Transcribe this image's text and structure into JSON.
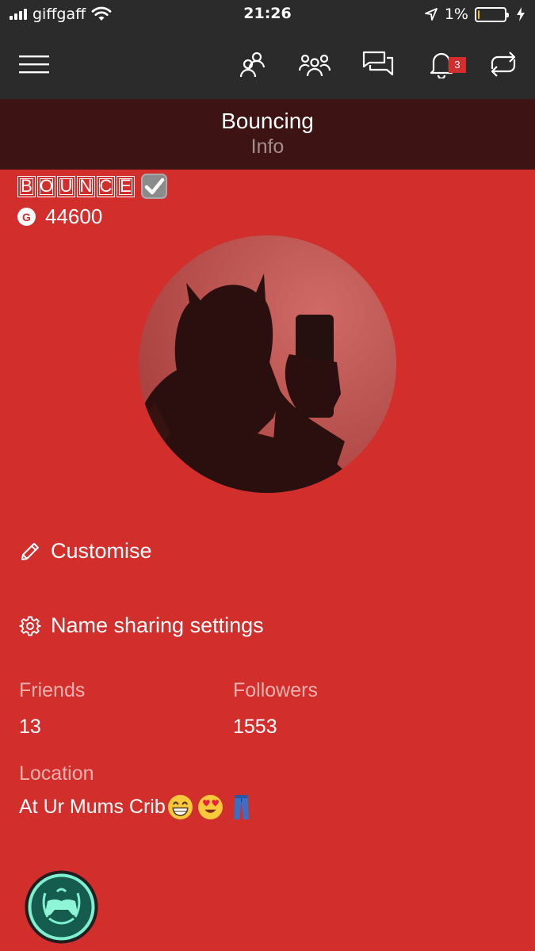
{
  "status_bar": {
    "carrier": "giffgaff",
    "time": "21:26",
    "battery_percent": "1%",
    "battery_level": 0.01,
    "icons": [
      "signal-bars-icon",
      "wifi-icon",
      "location-arrow-icon",
      "battery-icon",
      "charging-bolt-icon"
    ]
  },
  "topbar": {
    "icons": [
      "menu-icon",
      "friends-icon",
      "party-icon",
      "messages-icon",
      "notifications-icon",
      "activity-sync-icon"
    ],
    "notification_count": "3"
  },
  "header": {
    "title": "Bouncing",
    "subtitle": "Info"
  },
  "profile": {
    "gamertag_letters": [
      "B",
      "O",
      "U",
      "N",
      "C",
      "E"
    ],
    "verified_icon": "check-box-icon",
    "gamerscore": "44600",
    "gamerscore_icon": "G",
    "avatar_alt": "profile-picture"
  },
  "actions": {
    "customise_label": "Customise",
    "name_sharing_label": "Name sharing settings"
  },
  "stats": {
    "friends_label": "Friends",
    "friends_value": "13",
    "followers_label": "Followers",
    "followers_value": "1553",
    "location_label": "Location",
    "location_value": "At Ur Mums Crib"
  },
  "colors": {
    "accent_red": "#d12e2c",
    "bar_dark": "#2b2b2b",
    "header_dark": "#3d1413"
  }
}
